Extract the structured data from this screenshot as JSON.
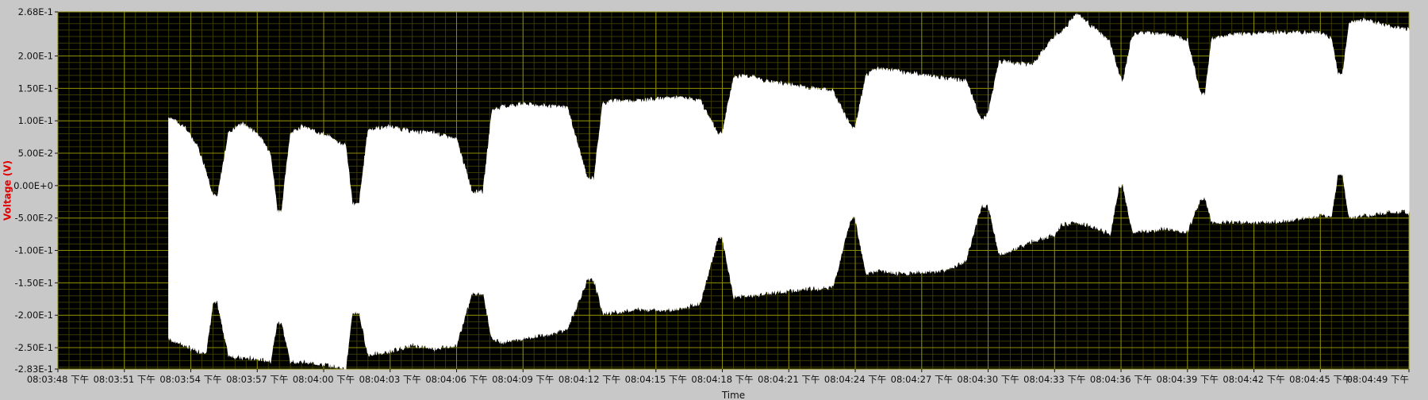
{
  "chart_data": {
    "type": "area",
    "title": "",
    "xlabel": "Time",
    "ylabel": "Voltage (V)",
    "ylim": [
      -0.283,
      0.268
    ],
    "xlim_seconds": [
      0,
      61
    ],
    "yticks": [
      {
        "value": 0.268,
        "label": "2.68E-1"
      },
      {
        "value": 0.2,
        "label": "2.00E-1"
      },
      {
        "value": 0.15,
        "label": "1.50E-1"
      },
      {
        "value": 0.1,
        "label": "1.00E-1"
      },
      {
        "value": 0.05,
        "label": "5.00E-2"
      },
      {
        "value": 0.0,
        "label": "0.00E+0"
      },
      {
        "value": -0.05,
        "label": "-5.00E-2"
      },
      {
        "value": -0.1,
        "label": "-1.00E-1"
      },
      {
        "value": -0.15,
        "label": "-1.50E-1"
      },
      {
        "value": -0.2,
        "label": "-2.00E-1"
      },
      {
        "value": -0.25,
        "label": "-2.50E-1"
      },
      {
        "value": -0.283,
        "label": "-2.83E-1"
      }
    ],
    "xticks": [
      {
        "value": 0,
        "label": "08:03:48 下午"
      },
      {
        "value": 3,
        "label": "08:03:51 下午"
      },
      {
        "value": 6,
        "label": "08:03:54 下午"
      },
      {
        "value": 9,
        "label": "08:03:57 下午"
      },
      {
        "value": 12,
        "label": "08:04:00 下午"
      },
      {
        "value": 15,
        "label": "08:04:03 下午"
      },
      {
        "value": 18,
        "label": "08:04:06 下午"
      },
      {
        "value": 21,
        "label": "08:04:09 下午"
      },
      {
        "value": 24,
        "label": "08:04:12 下午"
      },
      {
        "value": 27,
        "label": "08:04:15 下午"
      },
      {
        "value": 30,
        "label": "08:04:18 下午"
      },
      {
        "value": 33,
        "label": "08:04:21 下午"
      },
      {
        "value": 36,
        "label": "08:04:24 下午"
      },
      {
        "value": 39,
        "label": "08:04:27 下午"
      },
      {
        "value": 42,
        "label": "08:04:30 下午"
      },
      {
        "value": 45,
        "label": "08:04:33 下午"
      },
      {
        "value": 48,
        "label": "08:04:36 下午"
      },
      {
        "value": 51,
        "label": "08:04:39 下午"
      },
      {
        "value": 54,
        "label": "08:04:42 下午"
      },
      {
        "value": 57,
        "label": "08:04:45 下午"
      },
      {
        "value": 61,
        "label": "08:04:49 下午"
      }
    ],
    "grid": true,
    "colors": {
      "background": "#000000",
      "grid": "#8c8c00",
      "fill": "#ffffff",
      "ylabel": "#e00000",
      "frame": "#c8c8c8"
    },
    "series": [
      {
        "x": [
          5.0,
          5.7,
          6.3,
          6.7,
          7.0,
          7.2,
          7.7,
          8.3,
          9.0,
          9.6,
          9.9,
          10.1,
          10.5,
          11.0,
          12.0,
          13.0,
          13.3,
          13.6,
          14.0,
          15.0,
          16.0,
          17.0,
          18.0,
          18.7,
          19.2,
          19.6,
          20.0,
          21.0,
          22.5,
          23.0,
          23.9,
          24.2,
          24.6,
          25.0,
          26.0,
          28.0,
          29.0,
          29.8,
          30.0,
          30.5,
          31.0,
          32.0,
          35.0,
          35.8,
          36.0,
          36.5,
          37.0,
          38.0,
          40.0,
          41.0,
          41.7,
          42.0,
          42.5,
          43.0,
          44.0,
          45.0,
          45.3,
          46.0,
          47.0,
          47.5,
          47.9,
          48.1,
          48.5,
          49.0,
          50.0,
          51.0,
          51.6,
          51.8,
          52.1,
          53.0,
          55.0,
          57.0,
          57.5,
          57.8,
          58.0,
          58.3,
          59.0,
          60.0,
          61.0
        ],
        "upper": [
          0.105,
          0.09,
          0.06,
          0.02,
          -0.015,
          -0.02,
          0.08,
          0.095,
          0.08,
          0.05,
          -0.04,
          -0.04,
          0.08,
          0.09,
          0.078,
          0.06,
          -0.03,
          -0.03,
          0.085,
          0.09,
          0.082,
          0.08,
          0.07,
          -0.01,
          -0.01,
          0.115,
          0.12,
          0.125,
          0.12,
          0.12,
          0.01,
          0.01,
          0.125,
          0.13,
          0.13,
          0.135,
          0.13,
          0.08,
          0.08,
          0.165,
          0.17,
          0.16,
          0.145,
          0.09,
          0.09,
          0.17,
          0.18,
          0.175,
          0.165,
          0.16,
          0.1,
          0.11,
          0.19,
          0.19,
          0.185,
          0.23,
          0.235,
          0.265,
          0.235,
          0.22,
          0.17,
          0.16,
          0.23,
          0.235,
          0.232,
          0.225,
          0.14,
          0.14,
          0.225,
          0.232,
          0.235,
          0.235,
          0.225,
          0.17,
          0.17,
          0.25,
          0.255,
          0.245,
          0.24
        ],
        "lower": [
          -0.235,
          -0.245,
          -0.255,
          -0.255,
          -0.18,
          -0.18,
          -0.26,
          -0.265,
          -0.265,
          -0.27,
          -0.21,
          -0.21,
          -0.27,
          -0.27,
          -0.275,
          -0.28,
          -0.195,
          -0.195,
          -0.26,
          -0.255,
          -0.245,
          -0.25,
          -0.245,
          -0.165,
          -0.165,
          -0.235,
          -0.24,
          -0.235,
          -0.225,
          -0.22,
          -0.145,
          -0.145,
          -0.195,
          -0.195,
          -0.19,
          -0.19,
          -0.18,
          -0.08,
          -0.08,
          -0.17,
          -0.17,
          -0.165,
          -0.155,
          -0.05,
          -0.05,
          -0.135,
          -0.13,
          -0.135,
          -0.13,
          -0.115,
          -0.03,
          -0.03,
          -0.105,
          -0.1,
          -0.085,
          -0.075,
          -0.06,
          -0.055,
          -0.065,
          -0.075,
          0.0,
          0.0,
          -0.07,
          -0.07,
          -0.065,
          -0.07,
          -0.02,
          -0.02,
          -0.055,
          -0.055,
          -0.055,
          -0.045,
          -0.045,
          0.02,
          0.02,
          -0.05,
          -0.045,
          -0.04,
          -0.04
        ]
      }
    ]
  }
}
